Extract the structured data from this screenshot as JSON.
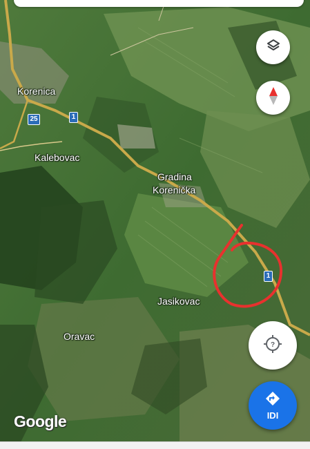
{
  "map": {
    "places": {
      "korenica": "Korenica",
      "kalebovac": "Kalebovac",
      "gradina_line1": "Gradina",
      "gradina_line2": "Korenička",
      "jasikovac": "Jasikovac",
      "oravac": "Oravac"
    },
    "route_shields": {
      "shield_25": "25",
      "shield_1_north": "1",
      "shield_1_south": "1"
    },
    "annotation": "hand-drawn red circle marking a location near the road",
    "logo": "Google"
  },
  "controls": {
    "layers_icon": "layers-icon",
    "compass_icon": "compass-icon",
    "location_help_icon": "location-help-icon",
    "directions_button_label": "IDI"
  },
  "colors": {
    "terrain_base": "#3f6a2f",
    "road": "#c9a94a",
    "marker_red": "#e8312e",
    "accent_blue": "#1a73e8",
    "shield_blue": "#2b6cb8"
  }
}
